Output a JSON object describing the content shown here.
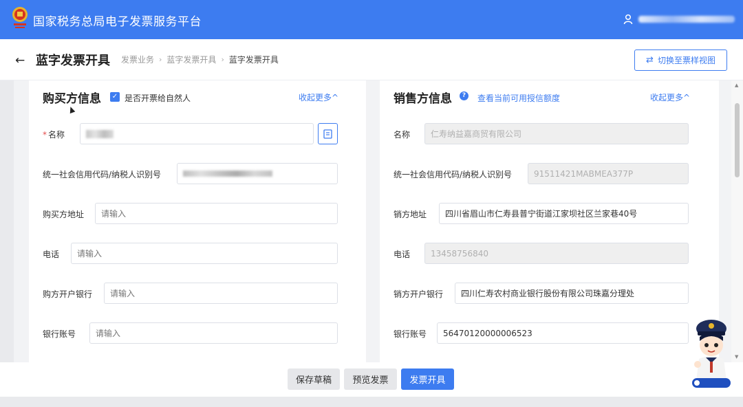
{
  "header": {
    "platform_title": "国家税务总局电子发票服务平台",
    "user_name_redacted": true
  },
  "page": {
    "title": "蓝字发票开具",
    "breadcrumbs": [
      "发票业务",
      "蓝字发票开具",
      "蓝字发票开具"
    ],
    "switch_button": "切换至票样视图"
  },
  "buyer": {
    "section_title": "购买方信息",
    "natural_person_checkbox": "是否开票给自然人",
    "natural_person_checked": true,
    "collapse_link": "收起更多^",
    "fields": {
      "name_label": "名称",
      "name_required_mark": "*",
      "credit_code_label": "统一社会信用代码/纳税人识别号",
      "address_label": "购买方地址",
      "address_placeholder": "请输入",
      "phone_label": "电话",
      "phone_placeholder": "请输入",
      "bank_label": "购方开户银行",
      "bank_placeholder": "请输入",
      "account_label": "银行账号",
      "account_placeholder": "请输入"
    }
  },
  "seller": {
    "section_title": "销售方信息",
    "quota_link": "查看当前可用授信额度",
    "collapse_link": "收起更多^",
    "fields": {
      "name_label": "名称",
      "name_value": "仁寿纳益嘉商贸有限公司",
      "credit_code_label": "统一社会信用代码/纳税人识别号",
      "credit_code_value": "91511421MABMEA377P",
      "address_label": "销方地址",
      "address_value": "四川省眉山市仁寿县普宁街道江家坝社区兰家巷40号",
      "phone_label": "电话",
      "phone_value": "13458756840",
      "bank_label": "销方开户银行",
      "bank_value": "四川仁寿农村商业银行股份有限公司珠嘉分理处",
      "account_label": "银行账号",
      "account_value": "56470120000006523"
    }
  },
  "actions": {
    "save_draft": "保存草稿",
    "preview": "预览发票",
    "issue": "发票开具"
  },
  "colors": {
    "brand": "#3d7cf0",
    "required": "#e34d4d"
  }
}
